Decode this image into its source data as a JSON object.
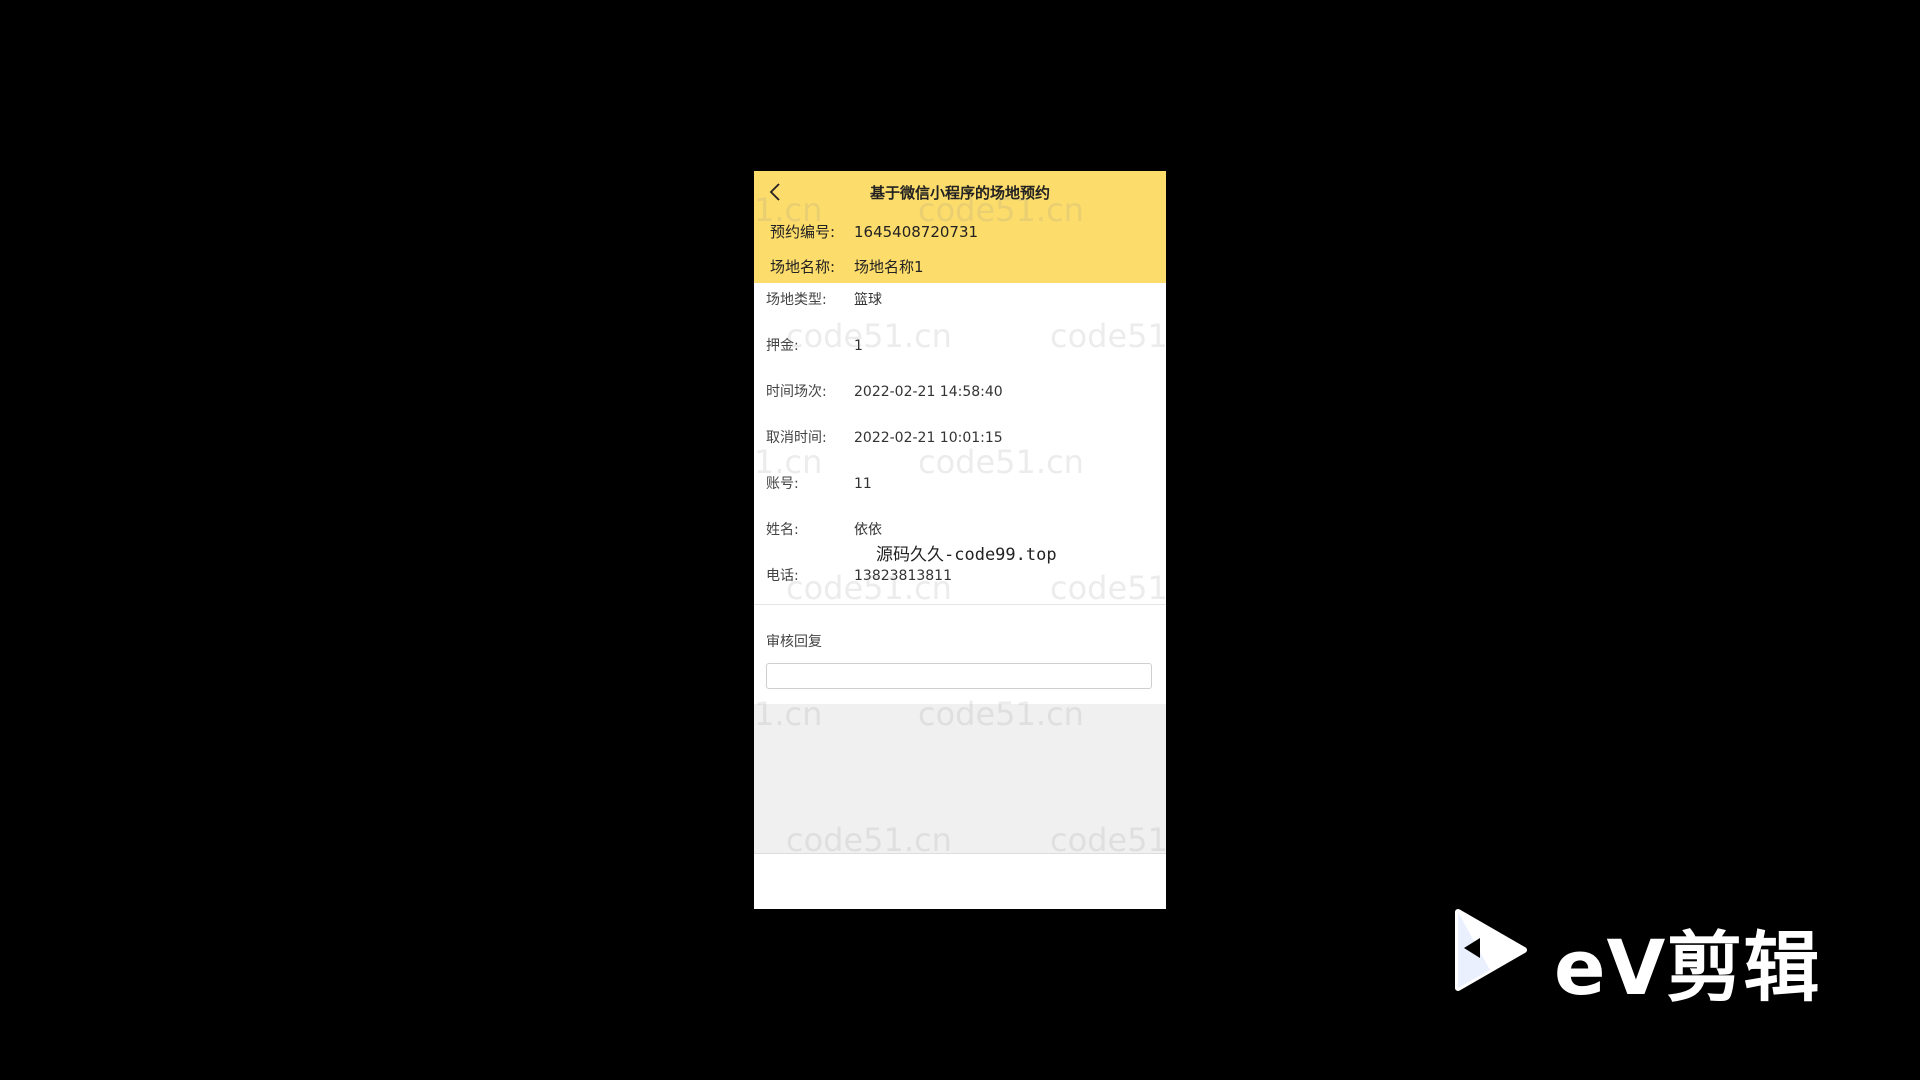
{
  "app": {
    "title": "基于微信小程序的场地预约"
  },
  "header": {
    "booking_no_label": "预约编号:",
    "booking_no_value": "1645408720731",
    "venue_name_label": "场地名称:",
    "venue_name_value": "场地名称1"
  },
  "fields": [
    {
      "label": "场地类型:",
      "value": "篮球"
    },
    {
      "label": "押金:",
      "value": "1"
    },
    {
      "label": "时间场次:",
      "value": "2022-02-21 14:58:40"
    },
    {
      "label": "取消时间:",
      "value": "2022-02-21 10:01:15"
    },
    {
      "label": "账号:",
      "value": "11"
    },
    {
      "label": "姓名:",
      "value": "依依"
    },
    {
      "label": "电话:",
      "value": "13823813811"
    }
  ],
  "review": {
    "label": "审核回复",
    "value": ""
  },
  "watermark": {
    "text": "code51.cn",
    "text_cut": "1.cn"
  },
  "overlay": {
    "text": "源码久久-code99.top"
  },
  "brand": {
    "logo_text": "eV剪辑",
    "play_icon": "play-icon"
  },
  "colors": {
    "header_bg": "#fcdc6a",
    "page_bg": "#000000",
    "panel_bg": "#f0f0f0"
  }
}
